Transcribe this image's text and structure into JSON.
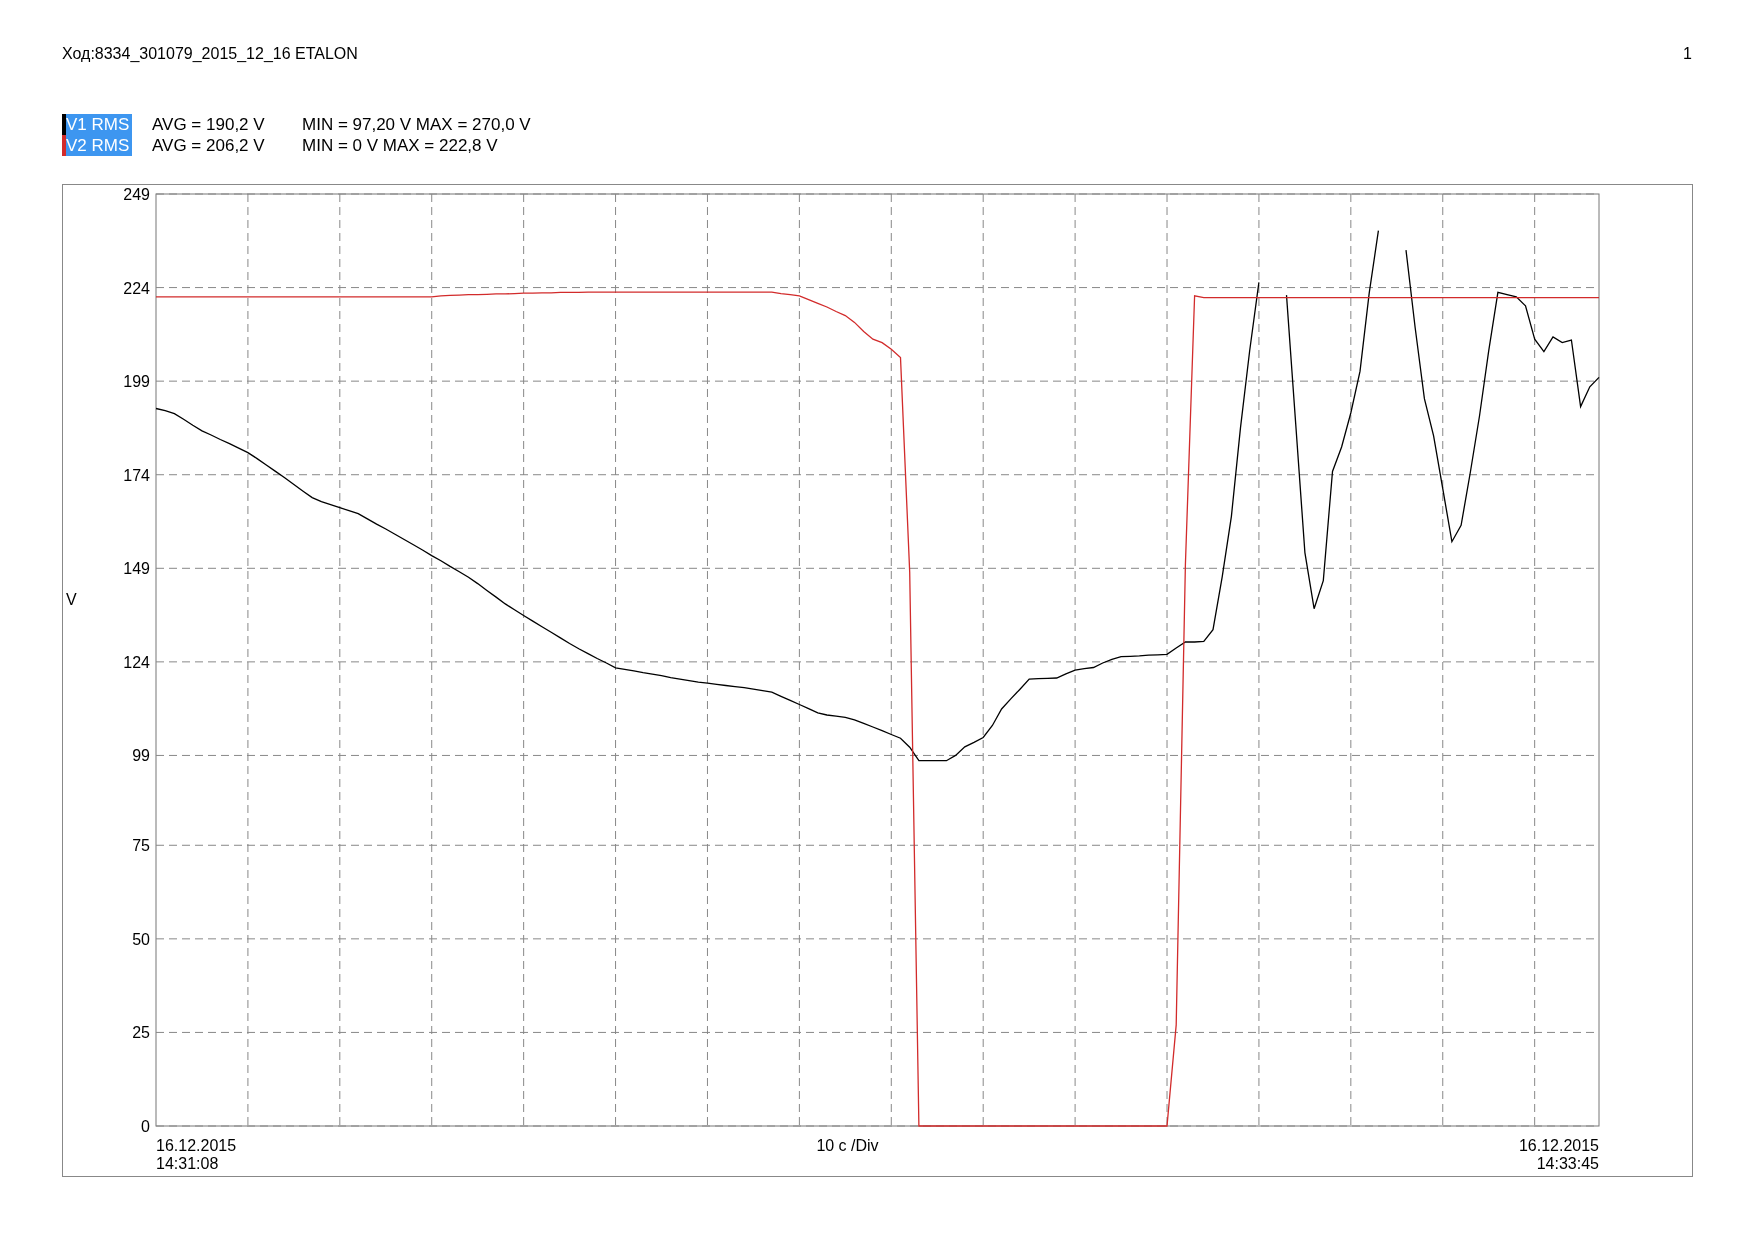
{
  "header": {
    "title": "Ход:8334_301079_2015_12_16 ETALON",
    "page_number": "1"
  },
  "legend": [
    {
      "avg": "AVG = 190,2 V",
      "range": "MIN = 97,20 V MAX = 270,0 V"
    },
    {
      "avg": "AVG = 206,2 V",
      "range": "MIN = 0 V MAX = 222,8 V"
    }
  ],
  "x_axis": {
    "start_date": "16.12.2015",
    "start_time": "14:31:08",
    "division": "10 c /Div",
    "end_date": "16.12.2015",
    "end_time": "14:33:45"
  },
  "chart_data": {
    "type": "line",
    "ylabel": "V",
    "ylim": [
      0,
      249
    ],
    "grid": true,
    "yticks": [
      0,
      25,
      50,
      75,
      99,
      124,
      149,
      174,
      199,
      224,
      249
    ],
    "categories": [
      null,
      null,
      null,
      null,
      null,
      null,
      null,
      null,
      null,
      null,
      null,
      null,
      null,
      null,
      null,
      null,
      null,
      null,
      null,
      null,
      null,
      null,
      null,
      null,
      null,
      null,
      null,
      null,
      null,
      null,
      null,
      null,
      null,
      null,
      null,
      null,
      null,
      null,
      null,
      null,
      null,
      null,
      null,
      null,
      null,
      null,
      null,
      null,
      null,
      null,
      null,
      null,
      null,
      null,
      null,
      null,
      null,
      null,
      null,
      null,
      null,
      null,
      null,
      null,
      null,
      null,
      null,
      null,
      null,
      null,
      null,
      null,
      null,
      null,
      null,
      null,
      null,
      null,
      null,
      null,
      null,
      null,
      null,
      null,
      null,
      null,
      null,
      null,
      null,
      null,
      null,
      null,
      null,
      null,
      null,
      null,
      null,
      null,
      null,
      null,
      null,
      null,
      null,
      null,
      null,
      null,
      null,
      null,
      null,
      null,
      null,
      null,
      null,
      null,
      null,
      null,
      null,
      null,
      null,
      null,
      null,
      null,
      null,
      null,
      null,
      null,
      null,
      null,
      null,
      null,
      null,
      null,
      null,
      null,
      null,
      null,
      null,
      null,
      null,
      null,
      null,
      null,
      null,
      null,
      null,
      null,
      null,
      null,
      null,
      null,
      null,
      null,
      null,
      null,
      null,
      null,
      null,
      null
    ],
    "series": [
      {
        "name": "V1 RMS",
        "color": "#000000",
        "values": [
          191.7,
          191.1,
          190.3,
          188.8,
          187.2,
          185.7,
          184.6,
          183.4,
          182.3,
          181.1,
          179.9,
          178.3,
          176.6,
          174.9,
          173.2,
          171.4,
          169.6,
          167.9,
          166.8,
          166.0,
          165.2,
          164.4,
          163.6,
          162.2,
          160.8,
          159.5,
          158.1,
          156.7,
          155.3,
          153.9,
          152.4,
          151.0,
          149.5,
          148.1,
          146.6,
          144.9,
          143.1,
          141.3,
          139.5,
          137.9,
          136.4,
          134.9,
          133.4,
          131.9,
          130.4,
          128.9,
          127.5,
          126.2,
          124.9,
          123.7,
          122.4,
          122.0,
          121.6,
          121.1,
          120.7,
          120.3,
          119.8,
          119.4,
          119.0,
          118.6,
          118.3,
          118.0,
          117.7,
          117.4,
          117.1,
          116.7,
          116.3,
          115.9,
          114.8,
          113.7,
          112.6,
          111.5,
          110.4,
          109.8,
          109.5,
          109.2,
          108.5,
          107.6,
          106.6,
          105.6,
          104.6,
          103.6,
          101.2,
          97.6,
          97.6,
          97.6,
          97.6,
          99.0,
          101.3,
          102.5,
          103.8,
          107.0,
          111.4,
          114.1,
          116.7,
          119.4,
          119.5,
          119.6,
          119.7,
          120.8,
          121.8,
          122.2,
          122.5,
          123.7,
          124.7,
          125.4,
          125.5,
          125.6,
          125.8,
          125.9,
          126.0,
          127.7,
          129.3,
          129.3,
          129.5,
          132.6,
          146.7,
          162.9,
          186.6,
          207.2,
          225.4,
          null,
          null,
          222.0,
          187.6,
          153.2,
          138.2,
          145.7,
          174.9,
          181.4,
          190.5,
          201.6,
          222.5,
          239.2,
          null,
          null,
          234.0,
          213.2,
          194.3,
          184.4,
          170.2,
          156.1,
          160.5,
          174.6,
          189.7,
          207.1,
          222.7,
          222.1,
          221.5,
          219.1,
          210.2,
          206.9,
          210.8,
          209.3,
          210.0,
          192.2,
          197.5,
          200.0
        ]
      },
      {
        "name": "V2 RMS",
        "color": "#d22b2b",
        "values": [
          221.5,
          221.5,
          221.5,
          221.5,
          221.5,
          221.5,
          221.5,
          221.5,
          221.5,
          221.5,
          221.5,
          221.5,
          221.5,
          221.5,
          221.5,
          221.5,
          221.5,
          221.5,
          221.5,
          221.5,
          221.5,
          221.5,
          221.5,
          221.5,
          221.5,
          221.5,
          221.5,
          221.5,
          221.5,
          221.5,
          221.5,
          221.8,
          221.9,
          222.0,
          222.1,
          222.1,
          222.2,
          222.3,
          222.3,
          222.4,
          222.5,
          222.5,
          222.6,
          222.6,
          222.7,
          222.7,
          222.7,
          222.8,
          222.8,
          222.8,
          222.8,
          222.8,
          222.8,
          222.8,
          222.8,
          222.8,
          222.8,
          222.8,
          222.8,
          222.8,
          222.8,
          222.8,
          222.8,
          222.8,
          222.8,
          222.8,
          222.8,
          222.8,
          222.4,
          222.1,
          221.8,
          220.8,
          219.8,
          218.8,
          217.6,
          216.5,
          214.7,
          212.3,
          210.2,
          209.3,
          207.5,
          205.3,
          148.0,
          0,
          0,
          0,
          0,
          0,
          0,
          0,
          0,
          0,
          0,
          0,
          0,
          0,
          0,
          0,
          0,
          0,
          0,
          0,
          0,
          0,
          0,
          0,
          0,
          0,
          0,
          0,
          0,
          27.0,
          150.0,
          221.8,
          221.3,
          221.3,
          221.3,
          221.3,
          221.3,
          221.3,
          221.3,
          221.3,
          221.3,
          221.3,
          221.3,
          221.3,
          221.3,
          221.3,
          221.3,
          221.3,
          221.3,
          221.3,
          221.3,
          221.3,
          221.3,
          221.3,
          221.3,
          221.3,
          221.3,
          221.3,
          221.3,
          221.3,
          221.3,
          221.3,
          221.3,
          221.3,
          221.3,
          221.3,
          221.3,
          221.3,
          221.3,
          221.3,
          221.3,
          221.3,
          221.3,
          221.3,
          221.3,
          221.3
        ]
      }
    ]
  }
}
